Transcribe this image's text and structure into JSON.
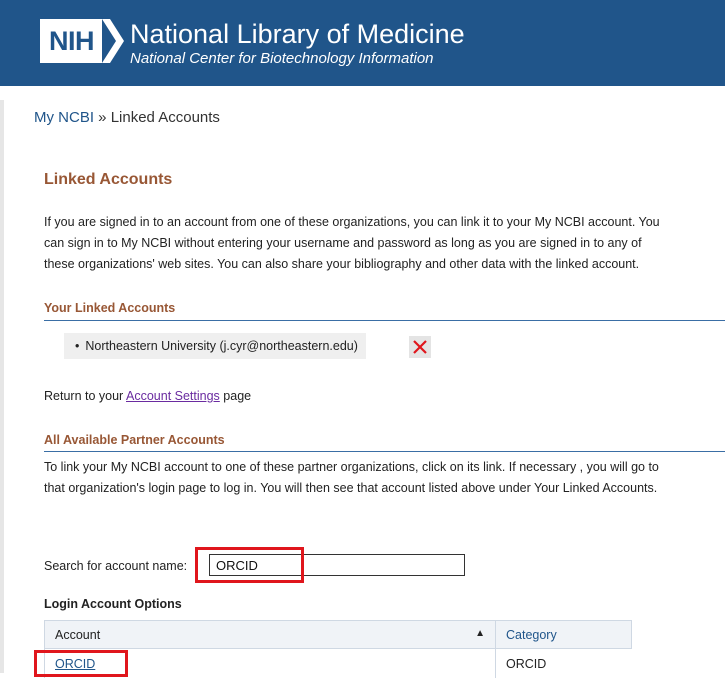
{
  "header": {
    "logo_text": "NIH",
    "title": "National Library of Medicine",
    "subtitle": "National Center for Biotechnology Information",
    "background": "#20558a"
  },
  "breadcrumb": {
    "root": "My NCBI",
    "separator": " » ",
    "current": "Linked Accounts"
  },
  "page": {
    "title": "Linked Accounts",
    "intro_lines": [
      "If you are signed in to an account from one of these organizations, you can link it to your My NCBI account. You",
      "can sign in to My NCBI without entering your username and password as long as you are signed in to any of",
      "these organizations' web sites. You can also share your bibliography and other data with the linked account."
    ]
  },
  "linked_accounts": {
    "heading": "Your Linked Accounts",
    "items": [
      {
        "label": "Northeastern University (j.cyr@northeastern.edu)"
      }
    ]
  },
  "return_link": {
    "before": "Return to your ",
    "link": "Account Settings",
    "after": " page"
  },
  "partner_accounts": {
    "heading": "All Available Partner Accounts",
    "lines": [
      "To link your My NCBI account to one of these partner organizations, click on its link. If necessary , you will go to",
      "that organization's login page to log in. You will then see that account listed above under Your Linked Accounts."
    ]
  },
  "search": {
    "label": "Search for account name:",
    "value": "ORCID"
  },
  "login_options": {
    "label": "Login Account Options",
    "columns": [
      "Account",
      "Category"
    ],
    "rows": [
      {
        "account": "ORCID",
        "category": "ORCID"
      }
    ]
  },
  "colors": {
    "heading_accent": "#985735",
    "link": "#20558a",
    "visited_link": "#6a2ba0",
    "highlight_box": "#e0161c",
    "section_rule": "#3a6ea5"
  }
}
